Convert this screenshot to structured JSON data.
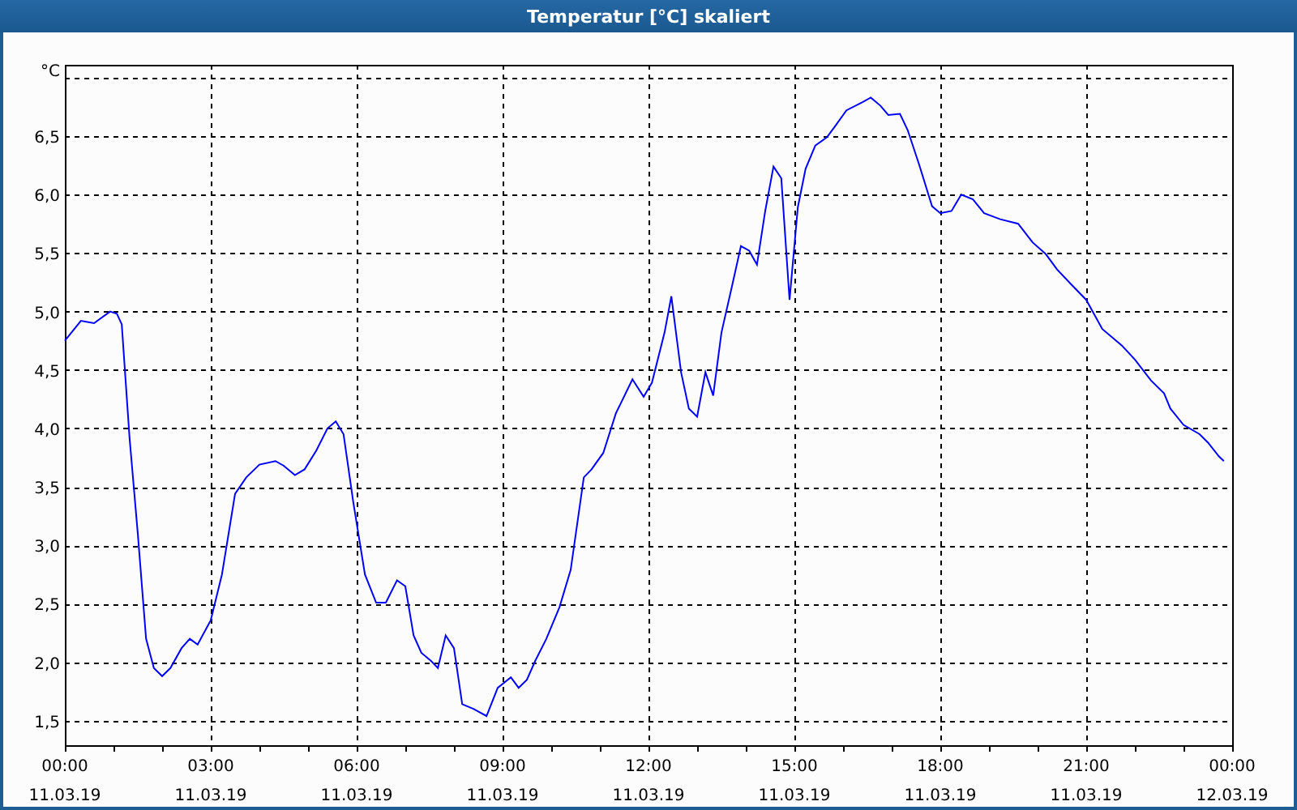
{
  "window": {
    "title": "Temperatur [°C] skaliert"
  },
  "chart": {
    "tick_dates": [
      "11.03.19",
      "11.03.19",
      "11.03.19",
      "11.03.19",
      "11.03.19",
      "11.03.19",
      "11.03.19",
      "11.03.19",
      "12.03.19"
    ],
    "chart_data": {
      "type": "line",
      "grid": true,
      "ylabel": "°C",
      "xlim": [
        0,
        24
      ],
      "ylim": [
        1.29,
        7.11
      ],
      "xticks": [
        {
          "value": 0,
          "label": "00:00"
        },
        {
          "value": 3,
          "label": "03:00"
        },
        {
          "value": 6,
          "label": "06:00"
        },
        {
          "value": 9,
          "label": "09:00"
        },
        {
          "value": 12,
          "label": "12:00"
        },
        {
          "value": 15,
          "label": "15:00"
        },
        {
          "value": 18,
          "label": "18:00"
        },
        {
          "value": 21,
          "label": "21:00"
        },
        {
          "value": 24,
          "label": "00:00"
        }
      ],
      "yticks": [
        {
          "value": 1.5,
          "label": "1,5"
        },
        {
          "value": 2,
          "label": "2,0"
        },
        {
          "value": 2.5,
          "label": "2,5"
        },
        {
          "value": 3,
          "label": "3,0"
        },
        {
          "value": 3.5,
          "label": "3,5"
        },
        {
          "value": 4,
          "label": "4,0"
        },
        {
          "value": 4.5,
          "label": "4,5"
        },
        {
          "value": 5,
          "label": "5,0"
        },
        {
          "value": 5.5,
          "label": "5,5"
        },
        {
          "value": 6,
          "label": "6,0"
        },
        {
          "value": 6.5,
          "label": "6,5"
        }
      ],
      "x": [
        0,
        0.33,
        0.6,
        0.93,
        1.07,
        1.17,
        1.33,
        1.5,
        1.67,
        1.83,
        2,
        2.17,
        2.4,
        2.57,
        2.73,
        3,
        3.23,
        3.5,
        3.73,
        4,
        4.33,
        4.5,
        4.73,
        4.93,
        5.17,
        5.4,
        5.57,
        5.73,
        5.93,
        6.17,
        6.4,
        6.6,
        6.83,
        7,
        7.17,
        7.33,
        7.53,
        7.67,
        7.83,
        8,
        8.17,
        8.4,
        8.67,
        8.9,
        9.17,
        9.33,
        9.5,
        9.67,
        9.9,
        10.17,
        10.4,
        10.67,
        10.83,
        11.07,
        11.33,
        11.67,
        11.9,
        12.07,
        12.33,
        12.47,
        12.67,
        12.83,
        13,
        13.17,
        13.33,
        13.5,
        13.73,
        13.9,
        14.07,
        14.23,
        14.4,
        14.57,
        14.73,
        14.9,
        15.07,
        15.23,
        15.43,
        15.67,
        15.83,
        16.07,
        16.4,
        16.57,
        16.77,
        16.93,
        17.17,
        17.33,
        17.57,
        17.83,
        18,
        18.23,
        18.43,
        18.67,
        18.9,
        19.23,
        19.6,
        19.9,
        20.17,
        20.4,
        20.67,
        21,
        21.33,
        21.73,
        22,
        22.33,
        22.6,
        22.73,
        23,
        23.33,
        23.5,
        23.73,
        23.83
      ],
      "series": [
        {
          "color": "#0000ff",
          "values": [
            4.75,
            4.92,
            4.9,
            5.0,
            4.98,
            4.89,
            3.92,
            3.1,
            2.2,
            1.95,
            1.88,
            1.95,
            2.12,
            2.2,
            2.15,
            2.36,
            2.75,
            3.44,
            3.58,
            3.69,
            3.72,
            3.68,
            3.6,
            3.65,
            3.81,
            4.0,
            4.06,
            3.95,
            3.37,
            2.75,
            2.51,
            2.51,
            2.7,
            2.65,
            2.23,
            2.08,
            2.01,
            1.95,
            2.23,
            2.12,
            1.64,
            1.6,
            1.54,
            1.78,
            1.87,
            1.78,
            1.85,
            2.01,
            2.2,
            2.47,
            2.79,
            3.58,
            3.65,
            3.79,
            4.13,
            4.42,
            4.27,
            4.39,
            4.82,
            5.13,
            4.48,
            4.17,
            4.1,
            4.48,
            4.28,
            4.82,
            5.24,
            5.56,
            5.52,
            5.4,
            5.86,
            6.24,
            6.14,
            5.1,
            5.89,
            6.22,
            6.42,
            6.49,
            6.58,
            6.72,
            6.79,
            6.83,
            6.76,
            6.68,
            6.69,
            6.55,
            6.25,
            5.9,
            5.84,
            5.86,
            6.0,
            5.96,
            5.84,
            5.79,
            5.75,
            5.59,
            5.49,
            5.36,
            5.24,
            5.1,
            4.85,
            4.71,
            4.59,
            4.41,
            4.3,
            4.17,
            4.03,
            3.95,
            3.88,
            3.76,
            3.72
          ]
        }
      ]
    }
  }
}
